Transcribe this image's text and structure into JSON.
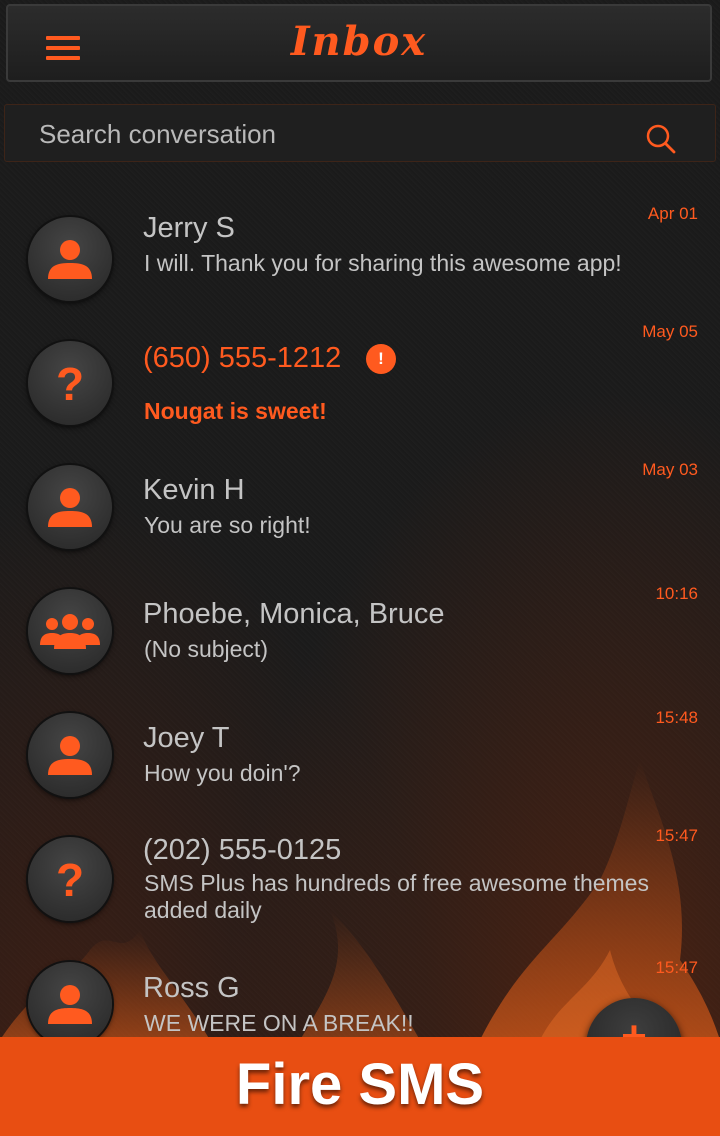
{
  "header": {
    "title": "Inbox"
  },
  "search": {
    "placeholder": "Search conversation"
  },
  "conversations": [
    {
      "name": "Jerry S",
      "preview": " I will. Thank you for sharing this awesome app!",
      "date": "Apr 01",
      "avatar": "person-icon",
      "unread": false
    },
    {
      "name": "(650) 555-1212",
      "preview": "Nougat is sweet!",
      "date": "May 05",
      "avatar": "unknown-contact-icon",
      "unread": true,
      "alert": "!"
    },
    {
      "name": "Kevin H",
      "preview": "You are so right!",
      "date": "May 03",
      "avatar": "person-icon",
      "unread": false
    },
    {
      "name": "Phoebe, Monica, Bruce",
      "preview": "(No subject)",
      "date": "10:16",
      "avatar": "group-icon",
      "unread": false
    },
    {
      "name": "Joey T",
      "preview": " How you doin'?",
      "date": "15:48",
      "avatar": "person-icon",
      "unread": false
    },
    {
      "name": "(202) 555-0125",
      "preview": " SMS Plus has hundreds of free awesome themes added daily",
      "date": "15:47",
      "avatar": "unknown-contact-icon",
      "unread": false
    },
    {
      "name": "Ross G",
      "preview": " WE WERE ON A BREAK!!",
      "date": "15:47",
      "avatar": "person-icon",
      "unread": false
    }
  ],
  "banner": {
    "text": "Fire SMS"
  },
  "colors": {
    "accent": "#ff5a1f",
    "banner": "#e84e12",
    "text": "#c4c4c4",
    "background": "#1b1b1b"
  }
}
